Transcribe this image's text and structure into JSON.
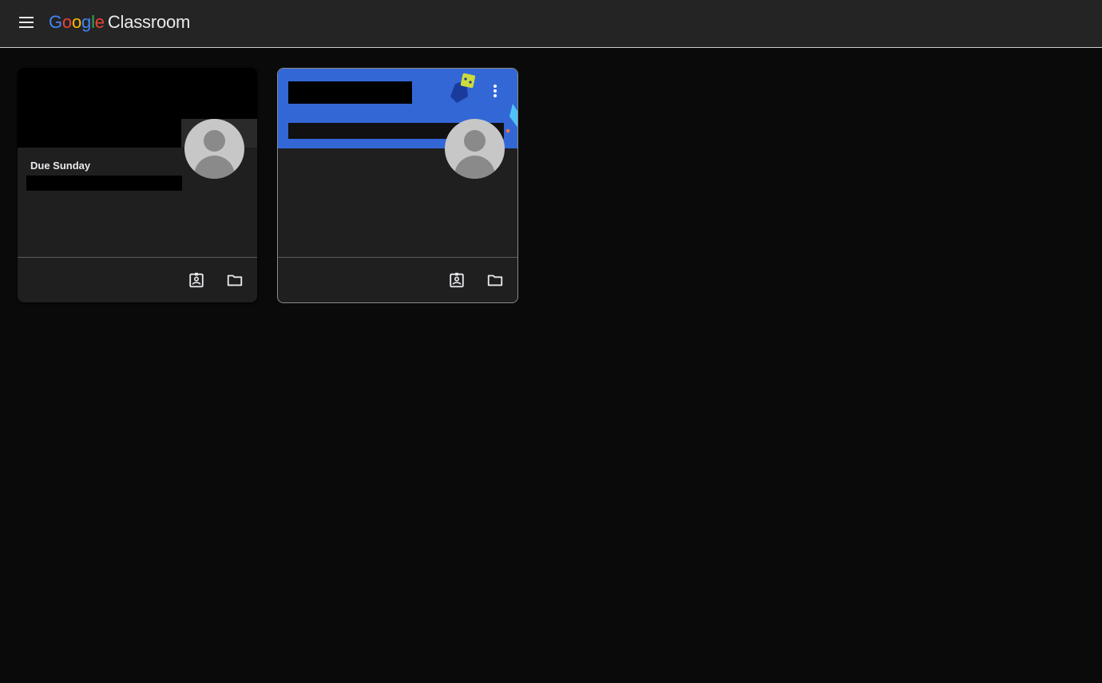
{
  "header": {
    "brand": [
      "G",
      "o",
      "o",
      "g",
      "l",
      "e"
    ],
    "brand_colors": [
      "#4285f4",
      "#ea4335",
      "#fbbc05",
      "#4285f4",
      "#34a853",
      "#ea4335"
    ],
    "product": "Classroom",
    "menu_icon": "hamburger-menu-icon"
  },
  "classes": [
    {
      "due_text": "Due Sunday",
      "banner_color": "#000000",
      "icons": [
        "assignment-ind-icon",
        "folder-icon"
      ]
    },
    {
      "banner_color": "#3367d6",
      "icons": [
        "more-vert-icon",
        "assignment-ind-icon",
        "folder-icon"
      ]
    }
  ]
}
